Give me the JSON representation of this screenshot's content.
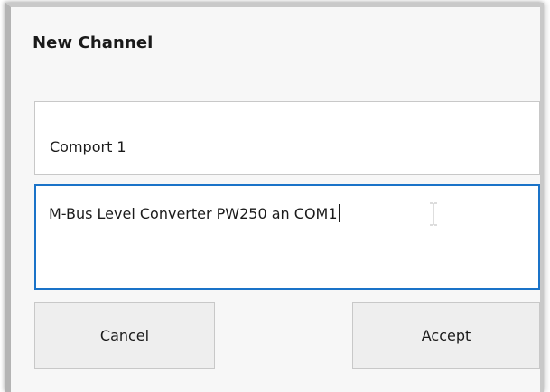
{
  "dialog": {
    "title": "New Channel",
    "name_field": {
      "value": "Comport 1"
    },
    "description_field": {
      "value": "M-Bus Level Converter PW250 an COM1"
    },
    "cancel_label": "Cancel",
    "accept_label": "Accept",
    "focus_color": "#1a73c8"
  }
}
